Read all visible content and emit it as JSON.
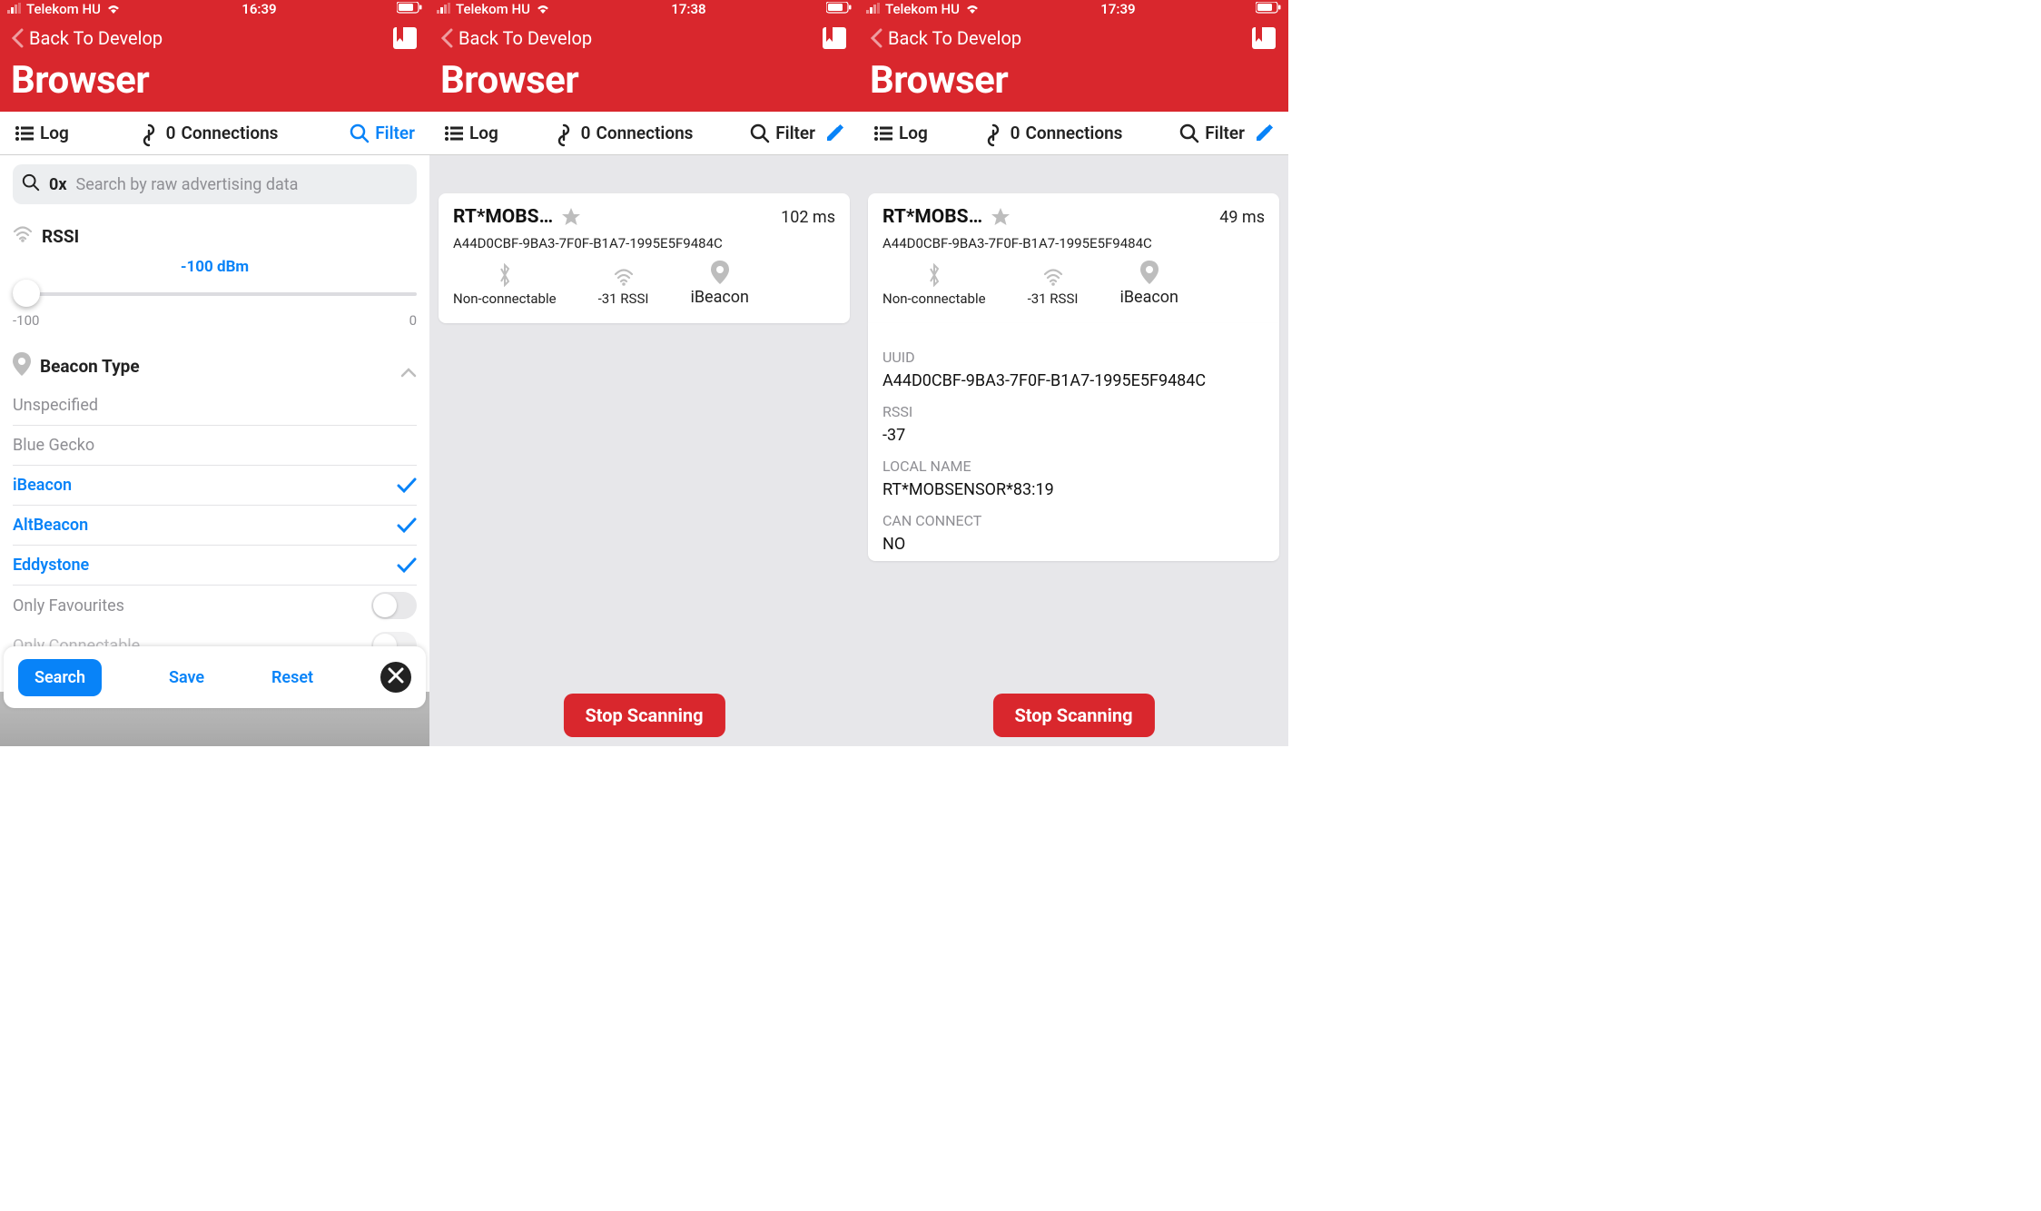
{
  "screens": [
    {
      "status": {
        "carrier": "Telekom HU",
        "time": "16:39"
      },
      "back_label": "Back To Develop",
      "title": "Browser",
      "toolbar": {
        "log": "Log",
        "connections_count": "0",
        "connections_label": "Connections",
        "filter": "Filter"
      },
      "filter": {
        "search_prefix": "0x",
        "search_placeholder": "Search by raw advertising data",
        "rssi_label": "RSSI",
        "rssi_value": "-100 dBm",
        "rssi_min": "-100",
        "rssi_max": "0",
        "beacon_type_label": "Beacon Type",
        "items": [
          {
            "label": "Unspecified",
            "selected": false
          },
          {
            "label": "Blue Gecko",
            "selected": false
          },
          {
            "label": "iBeacon",
            "selected": true
          },
          {
            "label": "AltBeacon",
            "selected": true
          },
          {
            "label": "Eddystone",
            "selected": true
          }
        ],
        "only_favourites_label": "Only Favourites",
        "only_connectable_label": "Only Connectable",
        "search_btn": "Search",
        "save_btn": "Save",
        "reset_btn": "Reset"
      }
    },
    {
      "status": {
        "carrier": "Telekom HU",
        "time": "17:38"
      },
      "back_label": "Back To Develop",
      "title": "Browser",
      "toolbar": {
        "log": "Log",
        "connections_count": "0",
        "connections_label": "Connections",
        "filter": "Filter"
      },
      "device": {
        "name": "RT*MOBS…",
        "latency": "102 ms",
        "uuid": "A44D0CBF-9BA3-7F0F-B1A7-1995E5F9484C",
        "connectable": "Non-connectable",
        "rssi": "-31 RSSI",
        "beacon": "iBeacon"
      },
      "stop_btn": "Stop Scanning"
    },
    {
      "status": {
        "carrier": "Telekom HU",
        "time": "17:39"
      },
      "back_label": "Back To Develop",
      "title": "Browser",
      "toolbar": {
        "log": "Log",
        "connections_count": "0",
        "connections_label": "Connections",
        "filter": "Filter"
      },
      "device": {
        "name": "RT*MOBS…",
        "latency": "49 ms",
        "uuid": "A44D0CBF-9BA3-7F0F-B1A7-1995E5F9484C",
        "connectable": "Non-connectable",
        "rssi": "-31 RSSI",
        "beacon": "iBeacon"
      },
      "detail": {
        "uuid_label": "UUID",
        "uuid_value": "A44D0CBF-9BA3-7F0F-B1A7-1995E5F9484C",
        "rssi_label": "RSSI",
        "rssi_value": "-37",
        "local_name_label": "LOCAL NAME",
        "local_name_value": "RT*MOBSENSOR*83:19",
        "can_connect_label": "CAN CONNECT",
        "can_connect_value": "NO"
      },
      "stop_btn": "Stop Scanning"
    }
  ]
}
